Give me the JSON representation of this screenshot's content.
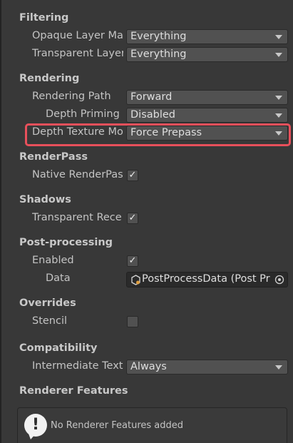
{
  "filtering": {
    "title": "Filtering",
    "opaque_label": "Opaque Layer Ma",
    "opaque_value": "Everything",
    "transparent_label": "Transparent Layer",
    "transparent_value": "Everything"
  },
  "rendering": {
    "title": "Rendering",
    "path_label": "Rendering Path",
    "path_value": "Forward",
    "depth_priming_label": "Depth Priming M",
    "depth_priming_value": "Disabled",
    "depth_texture_label": "Depth Texture Mo",
    "depth_texture_value": "Force Prepass"
  },
  "renderpass": {
    "title": "RenderPass",
    "native_label": "Native RenderPas",
    "native_checked": "✓"
  },
  "shadows": {
    "title": "Shadows",
    "transparent_receive_label": "Transparent Rece",
    "transparent_receive_checked": "✓"
  },
  "postprocessing": {
    "title": "Post-processing",
    "enabled_label": "Enabled",
    "enabled_checked": "✓",
    "data_label": "Data",
    "data_value": "PostProcessData (Post Pr"
  },
  "overrides": {
    "title": "Overrides",
    "stencil_label": "Stencil",
    "stencil_checked": ""
  },
  "compatibility": {
    "title": "Compatibility",
    "intermediate_label": "Intermediate Textu",
    "intermediate_value": "Always"
  },
  "renderer_features": {
    "title": "Renderer Features",
    "empty_message": "No Renderer Features added"
  },
  "colors": {
    "background": "#383838",
    "highlight": "#e8505b",
    "field": "#515151"
  }
}
